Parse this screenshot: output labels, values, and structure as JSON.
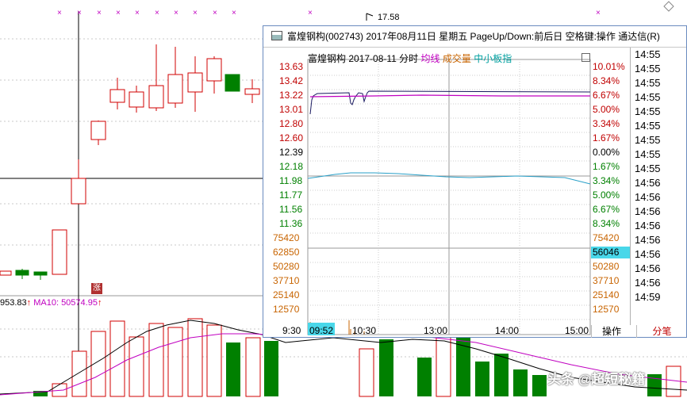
{
  "background": {
    "ma_text_prefix": "953.83",
    "ma10_label": "MA10: 50574.95",
    "up_arrow": "↑",
    "peak_label": "17.58",
    "zhang_badge": "涨"
  },
  "window": {
    "title": "富煌钢构(002743) 2017年08月11日 星期五 PageUp/Down:前后日 空格键:操作 通达信(R)",
    "header": {
      "name": "富煌钢构",
      "date": "2017-08-11 分时",
      "ma_label": "均线",
      "vol_label": "成交量",
      "index_label": "中小板指"
    },
    "price_labels": [
      "13.63",
      "13.42",
      "13.22",
      "13.01",
      "12.80",
      "12.60",
      "12.39",
      "12.18",
      "11.98",
      "11.77",
      "11.56",
      "11.36"
    ],
    "pct_labels": [
      "10.01%",
      "8.34%",
      "6.67%",
      "5.00%",
      "3.34%",
      "1.67%",
      "0.00%",
      "1.67%",
      "3.34%",
      "5.00%",
      "6.67%",
      "8.34%"
    ],
    "volume_labels_left": [
      "75420",
      "62850",
      "50280",
      "37710",
      "25140",
      "12570"
    ],
    "volume_labels_right": [
      "75420",
      "56046",
      "50280",
      "37710",
      "25140",
      "12570"
    ],
    "time_labels": [
      "9:30",
      "09:52",
      "10:30",
      "13:00",
      "14:00",
      "15:00"
    ],
    "buttons": {
      "caozuo": "操作",
      "fenbi": "分笔"
    },
    "ticks": [
      "14:55",
      "14:55",
      "14:55",
      "14:55",
      "14:55",
      "14:55",
      "14:55",
      "14:55",
      "14:55",
      "14:56",
      "14:56",
      "14:56",
      "14:56",
      "14:56",
      "14:56",
      "14:56",
      "14:56",
      "14:59"
    ]
  },
  "colors": {
    "up": "#e00000",
    "down": "#008000",
    "ma10": "#c000c0",
    "cursor": "#49d7e9"
  },
  "watermark": "头条 @超短秘籍"
}
